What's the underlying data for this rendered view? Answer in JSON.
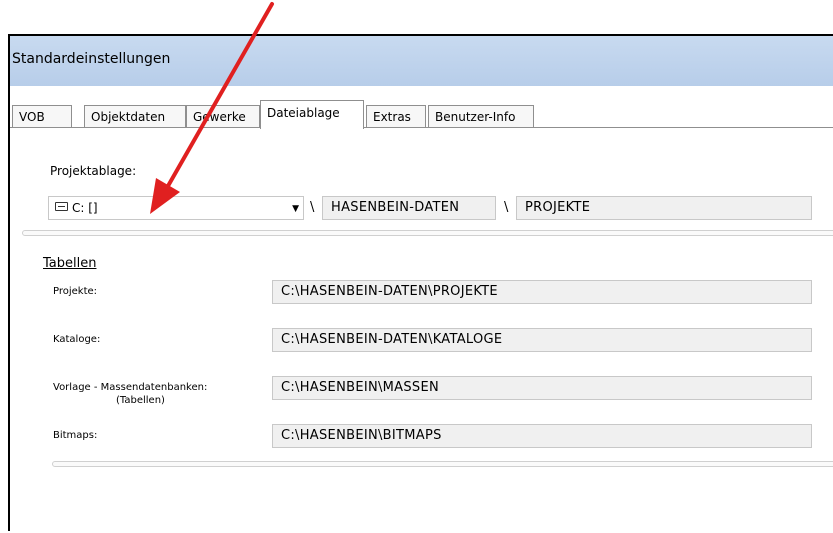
{
  "window": {
    "title": "Standardeinstellungen"
  },
  "tabs": [
    {
      "label": "VOB",
      "active": false
    },
    {
      "label": "Objektdaten",
      "active": false
    },
    {
      "label": "Gewerke",
      "active": false
    },
    {
      "label": "Dateiablage",
      "active": true
    },
    {
      "label": "Extras",
      "active": false
    },
    {
      "label": "Benutzer-Info",
      "active": false
    }
  ],
  "projektablage": {
    "label": "Projektablage:",
    "drive_value": "C: []",
    "separator1": "\\",
    "folder1": "HASENBEIN-DATEN",
    "separator2": "\\",
    "folder2": "PROJEKTE"
  },
  "tabellen": {
    "group_label": "Tabellen",
    "rows": [
      {
        "label": "Projekte:",
        "value": "C:\\HASENBEIN-DATEN\\PROJEKTE"
      },
      {
        "label": "Kataloge:",
        "value": "C:\\HASENBEIN-DATEN\\KATALOGE"
      },
      {
        "label": "Vorlage - Massendatenbanken:",
        "sublabel": "(Tabellen)",
        "value": "C:\\HASENBEIN\\MASSEN"
      },
      {
        "label": "Bitmaps:",
        "value": "C:\\HASENBEIN\\BITMAPS"
      }
    ]
  },
  "annotation": {
    "arrow_color": "#e02020"
  }
}
